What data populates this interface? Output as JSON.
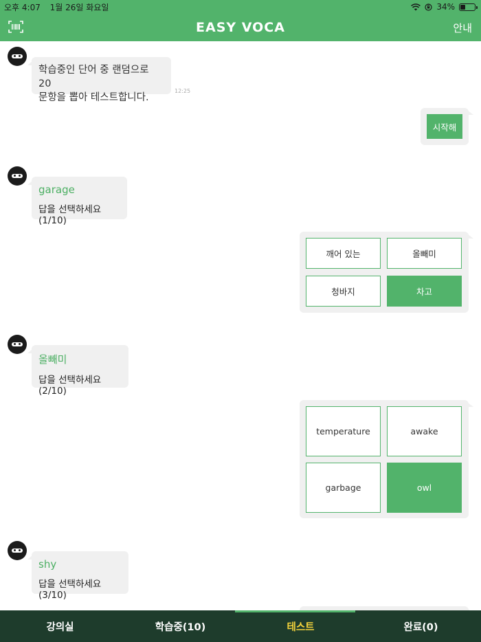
{
  "status_bar": {
    "time": "오후 4:07",
    "date": "1월 26일 화요일",
    "battery": "34%",
    "battery_level": 0.34
  },
  "nav": {
    "title": "EASY VOCA",
    "guide_label": "안내",
    "barcode_icon": "barcode-scan-icon"
  },
  "chat": {
    "intro": {
      "line1": "학습중인 단어 중 랜덤으로 20",
      "line2": "문항을 뽑아 테스트합니다.",
      "time": "12:25"
    },
    "start_label": "시작해",
    "questions": [
      {
        "word": "garage",
        "prompt": "답을 선택하세요(1/10)",
        "options": [
          "깨어 있는",
          "올빼미",
          "청바지",
          "차고"
        ],
        "selected": 3
      },
      {
        "word": "올빼미",
        "prompt": "답을 선택하세요(2/10)",
        "options": [
          "temperature",
          "awake",
          "garbage",
          "owl"
        ],
        "selected": 3
      },
      {
        "word": "shy",
        "prompt": "답을 선택하세요(3/10)"
      }
    ]
  },
  "tabs": [
    {
      "label": "강의실",
      "active": false
    },
    {
      "label": "학습중(10)",
      "active": false
    },
    {
      "label": "테스트",
      "active": true
    },
    {
      "label": "완료(0)",
      "active": false
    }
  ],
  "colors": {
    "accent": "#52b36b",
    "tabbar": "#1e3c2c",
    "active_tab": "#f6d43b",
    "bubble": "#f0f0f0"
  }
}
